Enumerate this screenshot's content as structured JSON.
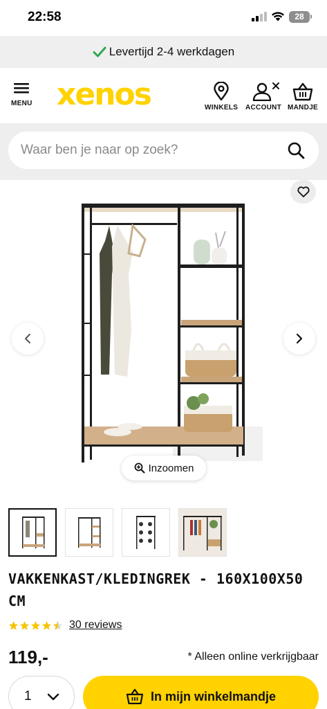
{
  "status_bar": {
    "time": "22:58",
    "battery": "28"
  },
  "banner": {
    "text": "Levertijd 2-4 werkdagen",
    "check_color": "#2fa84f"
  },
  "header": {
    "menu_label": "MENU",
    "logo_text": "xenos",
    "stores_label": "WINKELS",
    "account_label": "ACCOUNT",
    "cart_label": "MANDJE",
    "brand_color": "#ffd200"
  },
  "search": {
    "placeholder": "Waar ben je naar op zoek?"
  },
  "gallery": {
    "zoom_label": "Inzoomen",
    "thumbnail_count": 4,
    "active_thumbnail": 1
  },
  "product": {
    "title": "VAKKENKAST/KLEDINGREK - 160X100X50 CM",
    "rating": 4.5,
    "reviews_label": "30 reviews",
    "price": "119,-",
    "online_note": "* Alleen online verkrijgbaar"
  },
  "purchase": {
    "quantity": "1",
    "add_to_cart_label": "In mijn winkelmandje"
  }
}
